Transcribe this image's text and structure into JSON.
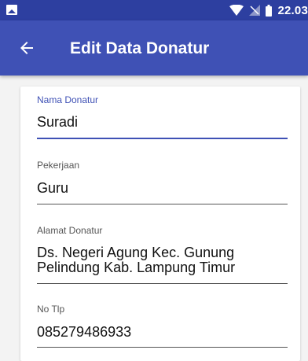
{
  "status_bar": {
    "time": "22.03",
    "icons": [
      "image-icon",
      "wifi-icon",
      "no-signal-icon",
      "battery-icon"
    ]
  },
  "app_bar": {
    "back_icon": "arrow-left-icon",
    "title": "Edit Data Donatur",
    "color": "#3f51b5"
  },
  "form": {
    "nama": {
      "label": "Nama Donatur",
      "value": "Suradi"
    },
    "pekerjaan": {
      "label": "Pekerjaan",
      "value": "Guru"
    },
    "alamat": {
      "label": "Alamat Donatur",
      "value_line1": "Ds. Negeri Agung Kec. Gunung",
      "value_line2": "Pelindung Kab. Lampung Timur"
    },
    "telp": {
      "label": "No Tlp",
      "value": "085279486933"
    }
  }
}
